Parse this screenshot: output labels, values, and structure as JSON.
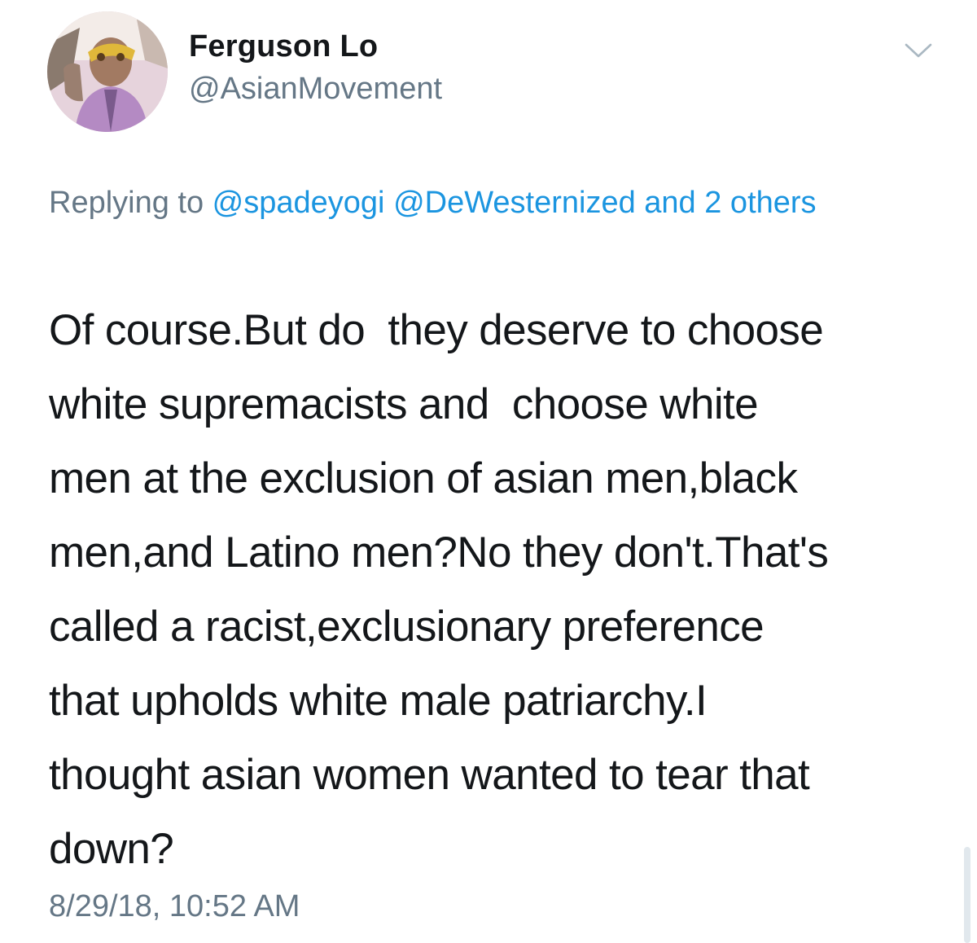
{
  "tweet": {
    "display_name": "Ferguson Lo",
    "handle": "@AsianMovement",
    "avatar_icon": "profile-photo",
    "menu_icon": "chevron-down-icon",
    "replying": {
      "prefix": "Replying to ",
      "mention_1": "@spadeyogi",
      "mention_2": "@DeWesternized",
      "others": "and 2 others"
    },
    "body_lines": [
      "Of course.But do  they deserve to choose",
      "white supremacists and  choose white",
      "men at the exclusion of asian men,black",
      "men,and Latino men?No they don't.That's",
      "called a racist,exclusionary preference",
      "that upholds white male patriarchy.I",
      "thought asian women wanted to tear that",
      "down?"
    ],
    "timestamp": "8/29/18, 10:52 AM"
  },
  "colors": {
    "text": "#14171a",
    "secondary": "#657786",
    "link": "#1b95e0"
  }
}
